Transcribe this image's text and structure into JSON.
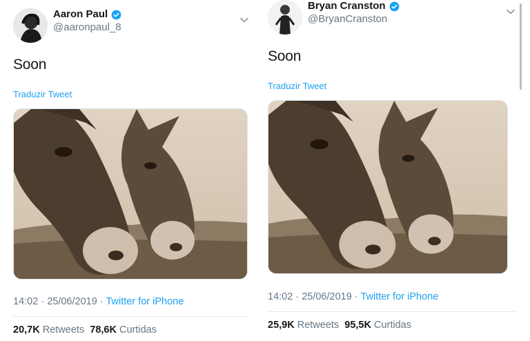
{
  "tweets": [
    {
      "author_name": "Aaron Paul",
      "handle": "@aaronpaul_8",
      "verified": true,
      "text": "Soon",
      "translate_label": "Traduzir Tweet",
      "time": "14:02",
      "date": "25/06/2019",
      "source": "Twitter for iPhone",
      "retweets_count": "20,7K",
      "retweets_label": "Retweets",
      "likes_count": "78,6K",
      "likes_label": "Curtidas"
    },
    {
      "author_name": "Bryan Cranston",
      "handle": "@BryanCranston",
      "verified": true,
      "text": "Soon",
      "translate_label": "Traduzir Tweet",
      "time": "14:02",
      "date": "25/06/2019",
      "source": "Twitter for iPhone",
      "retweets_count": "25,9K",
      "retweets_label": "Retweets",
      "likes_count": "95,5K",
      "likes_label": "Curtidas"
    }
  ],
  "separator": "·",
  "icons": {
    "verified": "verified-badge-icon",
    "menu": "chevron-down-icon"
  },
  "colors": {
    "link": "#1da1f2",
    "verified": "#1da1f2",
    "secondary_text": "#657786",
    "primary_text": "#14171a"
  }
}
